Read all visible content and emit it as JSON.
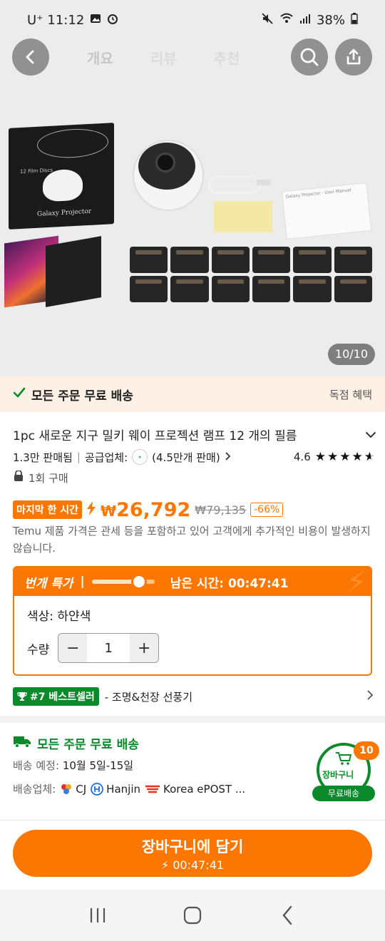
{
  "status_bar": {
    "carrier_time": "U⁺ 11:12",
    "battery": "38%"
  },
  "nav": {
    "tabs": [
      "개요",
      "리뷰",
      "추천"
    ]
  },
  "gallery": {
    "counter": "10/10"
  },
  "promo": {
    "free_shipping": "모든 주문 무료 배송",
    "exclusive": "독점 혜택"
  },
  "product": {
    "title": "1pc 새로운 지구 밀키 웨이 프로젝션 램프 12 개의 필름",
    "sold": "1.3만 판매됨",
    "supplier_label": "공급업체:",
    "supplier_sales": "(4.5만개 판매)",
    "rating": "4.6",
    "rating_stars": 4.6,
    "purchase_limit": "1회 구매"
  },
  "pricing": {
    "last_hour_badge": "마지막 한 시간",
    "currency": "₩",
    "price": "26,792",
    "original_price": "₩79,135",
    "discount": "-66%",
    "note": "Temu 제품 가격은 관세 등을 포함하고 있어 고객에게 추가적인 비용이 발생하지 않습니다."
  },
  "flash_deal": {
    "name": "번개 특가",
    "separator": "|",
    "remaining_label": "남은 시간: 00:47:41",
    "progress": 0.75,
    "color_label": "색상: 하얀색",
    "qty_label": "수량",
    "qty_value": "1",
    "minus": "−",
    "plus": "+"
  },
  "bestseller": {
    "rank": "#7 베스트셀러",
    "category": "- 조명&천장 선풍기"
  },
  "shipping": {
    "title": "모든 주문 무료 배송",
    "eta_label": "배송 예정:",
    "eta": "10월 5일-15일",
    "carriers_label": "배송업체:",
    "carriers": [
      "CJ",
      "Hanjin",
      "Korea ePOST ..."
    ]
  },
  "cart_float": {
    "count": "10",
    "label": "장바구니",
    "free": "무료배송"
  },
  "cta": {
    "label": "장바구니에 담기",
    "timer": "⚡ 00:47:41"
  },
  "colors": {
    "accent": "#fb7701",
    "green": "#0a8a2a",
    "promo_bg": "#fdf1e6"
  }
}
